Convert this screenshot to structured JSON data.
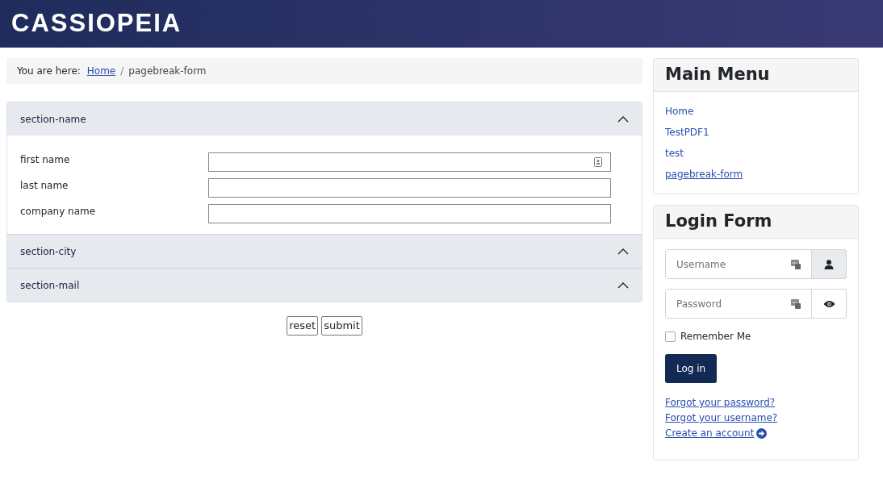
{
  "header": {
    "logo": "CASSIOPEIA"
  },
  "breadcrumb": {
    "label": "You are here:",
    "items": [
      {
        "text": "Home",
        "link": true
      },
      {
        "text": "pagebreak-form",
        "link": false
      }
    ],
    "separator": "/"
  },
  "sections": [
    {
      "title": "section-name",
      "expanded": true,
      "fields": [
        {
          "label": "first name",
          "autofill_icon": true
        },
        {
          "label": "last name",
          "autofill_icon": false
        },
        {
          "label": "company name",
          "autofill_icon": false
        }
      ]
    },
    {
      "title": "section-city",
      "expanded": false
    },
    {
      "title": "section-mail",
      "expanded": false
    }
  ],
  "form_buttons": [
    "reset",
    "submit"
  ],
  "main_menu": {
    "title": "Main Menu",
    "items": [
      {
        "label": "Home",
        "selected": false
      },
      {
        "label": "TestPDF1",
        "selected": false
      },
      {
        "label": "test",
        "selected": false
      },
      {
        "label": "pagebreak-form",
        "selected": true
      }
    ]
  },
  "login_form": {
    "title": "Login Form",
    "username": {
      "placeholder": "Username"
    },
    "password": {
      "placeholder": "Password"
    },
    "remember": {
      "label": "Remember Me",
      "checked": false
    },
    "button": "Log in",
    "links": [
      {
        "text": "Forgot your password?",
        "arrow": false
      },
      {
        "text": "Forgot your username?",
        "arrow": false
      },
      {
        "text": "Create an account",
        "arrow": true
      }
    ]
  }
}
